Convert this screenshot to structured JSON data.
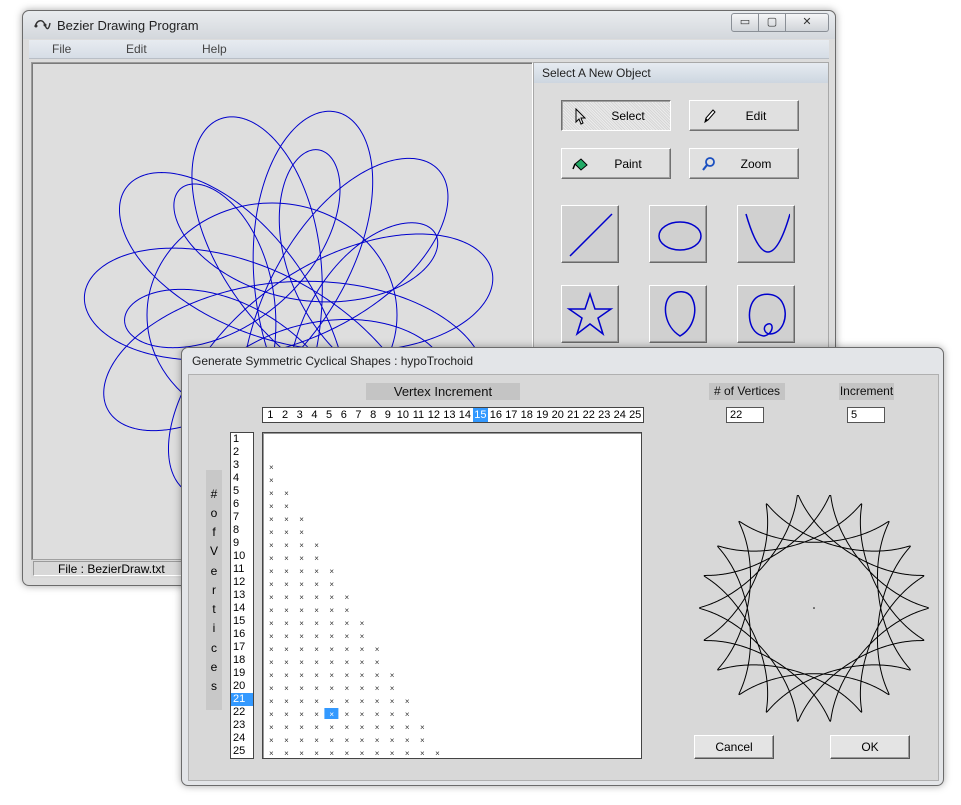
{
  "main_window": {
    "title": "Bezier Drawing Program",
    "controls": {
      "minimize": "▭",
      "maximize": "▢",
      "close": "✕"
    },
    "menu": [
      "File",
      "Edit",
      "Help"
    ],
    "status": "File :  BezierDraw.txt",
    "curve_color": "#0000cc"
  },
  "tool_panel": {
    "header": "Select A New Object",
    "tools": [
      {
        "label": "Select",
        "icon": "pointer-icon",
        "pressed": true
      },
      {
        "label": "Edit",
        "icon": "pencil-icon",
        "pressed": false
      },
      {
        "label": "Paint",
        "icon": "paint-bucket-icon",
        "pressed": false
      },
      {
        "label": "Zoom",
        "icon": "magnifier-icon",
        "pressed": false
      }
    ],
    "shapes": [
      "line-icon",
      "ellipse-icon",
      "parabola-icon",
      "star-icon",
      "teardrop-icon",
      "loop-icon"
    ]
  },
  "dialog": {
    "title": "Generate Symmetric Cyclical Shapes : hypoTrochoid",
    "vertex_increment_label": "Vertex Increment",
    "increments": [
      "1",
      "2",
      "3",
      "4",
      "5",
      "6",
      "7",
      "8",
      "9",
      "10",
      "11",
      "12",
      "13",
      "14",
      "15",
      "16",
      "17",
      "18",
      "19",
      "20",
      "21",
      "22",
      "23",
      "24",
      "25"
    ],
    "selected_increment": 15,
    "vertices_axis_label": [
      "#",
      "o",
      "f",
      "V",
      "e",
      "r",
      "t",
      "i",
      "c",
      "e",
      "s"
    ],
    "vertices": [
      "1",
      "2",
      "3",
      "4",
      "5",
      "6",
      "7",
      "8",
      "9",
      "10",
      "11",
      "12",
      "13",
      "14",
      "15",
      "16",
      "17",
      "18",
      "19",
      "20",
      "21",
      "22",
      "23",
      "24",
      "25"
    ],
    "selected_vertex": 21,
    "marker": "×",
    "highlight_cell": {
      "vertices": 22,
      "increment": 5
    },
    "num_vertices_label": "# of Vertices",
    "num_vertices_value": "22",
    "increment_label": "Increment",
    "increment_value": "5",
    "cancel_label": "Cancel",
    "ok_label": "OK",
    "accent": "#3399ff"
  }
}
